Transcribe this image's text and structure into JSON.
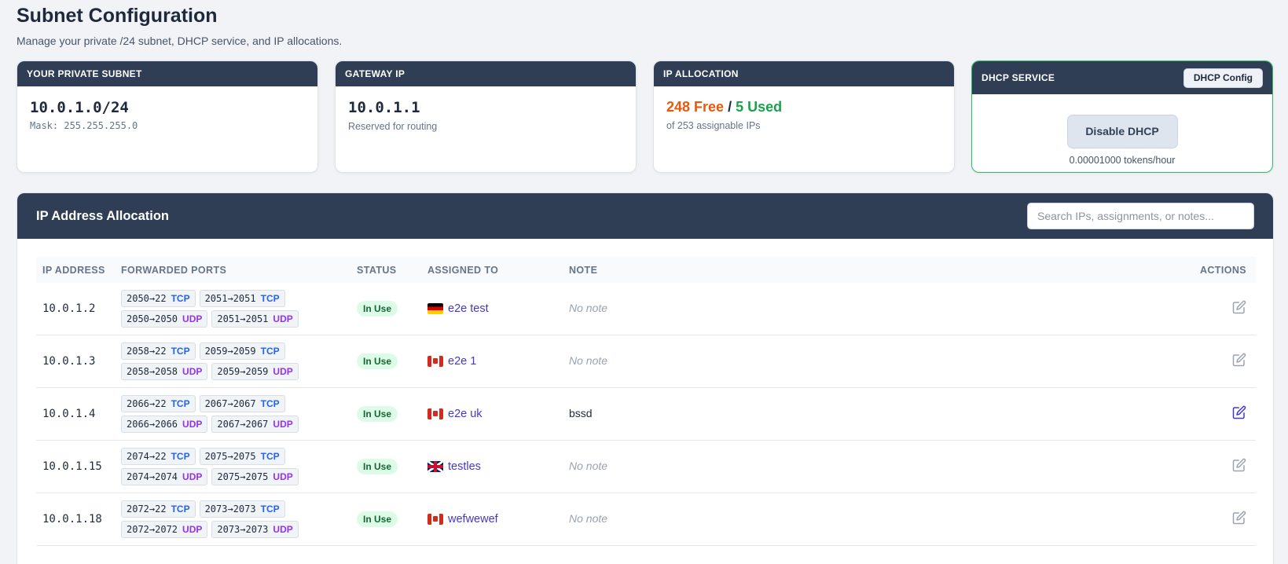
{
  "page": {
    "title": "Subnet Configuration",
    "subtitle": "Manage your private /24 subnet, DHCP service, and IP allocations."
  },
  "cards": {
    "subnet": {
      "header": "YOUR PRIVATE SUBNET",
      "value": "10.0.1.0/24",
      "mask": "Mask: 255.255.255.0"
    },
    "gateway": {
      "header": "GATEWAY IP",
      "value": "10.0.1.1",
      "note": "Reserved for routing"
    },
    "allocation": {
      "header": "IP ALLOCATION",
      "free": "248 Free",
      "separator": "/",
      "used": "5 Used",
      "note": "of 253 assignable IPs"
    },
    "dhcp": {
      "header": "DHCP SERVICE",
      "config_button": "DHCP Config",
      "disable_button": "Disable DHCP",
      "rate": "0.00001000 tokens/hour"
    }
  },
  "allocation_table": {
    "title": "IP Address Allocation",
    "search_placeholder": "Search IPs, assignments, or notes...",
    "columns": {
      "ip": "IP ADDRESS",
      "ports": "FORWARDED PORTS",
      "status": "STATUS",
      "assigned": "ASSIGNED TO",
      "note": "NOTE",
      "actions": "ACTIONS"
    },
    "rows": [
      {
        "ip": "10.0.1.2",
        "ports": [
          [
            {
              "map": "2050→22",
              "proto": "TCP"
            },
            {
              "map": "2051→2051",
              "proto": "TCP"
            }
          ],
          [
            {
              "map": "2050→2050",
              "proto": "UDP"
            },
            {
              "map": "2051→2051",
              "proto": "UDP"
            }
          ]
        ],
        "status": "In Use",
        "flag": "de",
        "assigned": "e2e test",
        "note": "No note",
        "note_empty": true
      },
      {
        "ip": "10.0.1.3",
        "ports": [
          [
            {
              "map": "2058→22",
              "proto": "TCP"
            },
            {
              "map": "2059→2059",
              "proto": "TCP"
            }
          ],
          [
            {
              "map": "2058→2058",
              "proto": "UDP"
            },
            {
              "map": "2059→2059",
              "proto": "UDP"
            }
          ]
        ],
        "status": "In Use",
        "flag": "ca",
        "assigned": "e2e 1",
        "note": "No note",
        "note_empty": true
      },
      {
        "ip": "10.0.1.4",
        "ports": [
          [
            {
              "map": "2066→22",
              "proto": "TCP"
            },
            {
              "map": "2067→2067",
              "proto": "TCP"
            }
          ],
          [
            {
              "map": "2066→2066",
              "proto": "UDP"
            },
            {
              "map": "2067→2067",
              "proto": "UDP"
            }
          ]
        ],
        "status": "In Use",
        "flag": "ca",
        "assigned": "e2e uk",
        "note": "bssd",
        "note_empty": false
      },
      {
        "ip": "10.0.1.15",
        "ports": [
          [
            {
              "map": "2074→22",
              "proto": "TCP"
            },
            {
              "map": "2075→2075",
              "proto": "TCP"
            }
          ],
          [
            {
              "map": "2074→2074",
              "proto": "UDP"
            },
            {
              "map": "2075→2075",
              "proto": "UDP"
            }
          ]
        ],
        "status": "In Use",
        "flag": "gb",
        "assigned": "testles",
        "note": "No note",
        "note_empty": true
      },
      {
        "ip": "10.0.1.18",
        "ports": [
          [
            {
              "map": "2072→22",
              "proto": "TCP"
            },
            {
              "map": "2073→2073",
              "proto": "TCP"
            }
          ],
          [
            {
              "map": "2072→2072",
              "proto": "UDP"
            },
            {
              "map": "2073→2073",
              "proto": "UDP"
            }
          ]
        ],
        "status": "In Use",
        "flag": "ca",
        "assigned": "wefwewef",
        "note": "No note",
        "note_empty": true
      }
    ]
  },
  "colors": {
    "header_bg": "#2f3e55",
    "free": "#ea580c",
    "used": "#16a34a",
    "tcp": "#2563eb",
    "udp": "#9333ea",
    "link": "#4338ca",
    "dhcp_border": "#22c55e"
  },
  "icons": {
    "edit": "edit-icon"
  }
}
